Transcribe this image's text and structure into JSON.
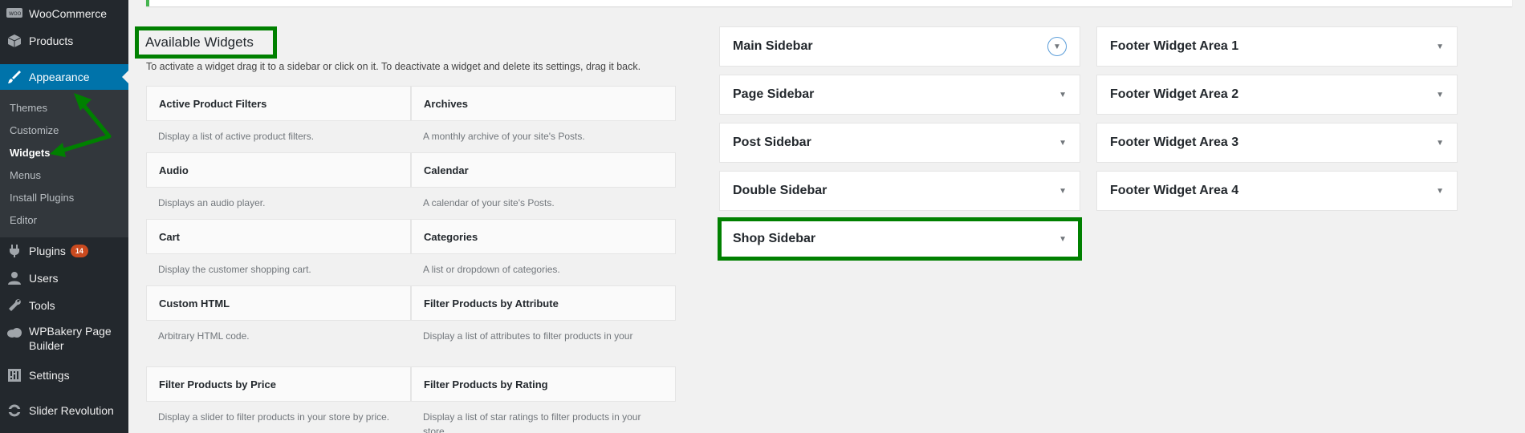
{
  "menu": {
    "woocommerce": "WooCommerce",
    "products": "Products",
    "appearance": "Appearance",
    "submenu": [
      "Themes",
      "Customize",
      "Widgets",
      "Menus",
      "Install Plugins",
      "Editor"
    ],
    "plugins": "Plugins",
    "plugins_badge": "14",
    "users": "Users",
    "tools": "Tools",
    "wpbakery_line1": "WPBakery Page",
    "wpbakery_line2": "Builder",
    "settings": "Settings",
    "slider": "Slider Revolution"
  },
  "available": {
    "title": "Available Widgets",
    "description": "To activate a widget drag it to a sidebar or click on it. To deactivate a widget and delete its settings, drag it back."
  },
  "widgets": [
    {
      "title": "Active Product Filters",
      "desc": "Display a list of active product filters."
    },
    {
      "title": "Archives",
      "desc": "A monthly archive of your site's Posts."
    },
    {
      "title": "Audio",
      "desc": "Displays an audio player."
    },
    {
      "title": "Calendar",
      "desc": "A calendar of your site's Posts."
    },
    {
      "title": "Cart",
      "desc": "Display the customer shopping cart."
    },
    {
      "title": "Categories",
      "desc": "A list or dropdown of categories."
    },
    {
      "title": "Custom HTML",
      "desc": "Arbitrary HTML code."
    },
    {
      "title": "Filter Products by Attribute",
      "desc": "Display a list of attributes to filter products in your"
    },
    {
      "title": "Filter Products by Price",
      "desc": "Display a slider to filter products in your store by price."
    },
    {
      "title": "Filter Products by Rating",
      "desc": "Display a list of star ratings to filter products in your store."
    }
  ],
  "sidebars_left": [
    "Main Sidebar",
    "Page Sidebar",
    "Post Sidebar",
    "Double Sidebar",
    "Shop Sidebar"
  ],
  "sidebars_right": [
    "Footer Widget Area 1",
    "Footer Widget Area 2",
    "Footer Widget Area 3",
    "Footer Widget Area 4"
  ],
  "colors": {
    "annotation_green": "#008000",
    "admin_bg": "#23282d",
    "admin_active": "#0073aa"
  }
}
